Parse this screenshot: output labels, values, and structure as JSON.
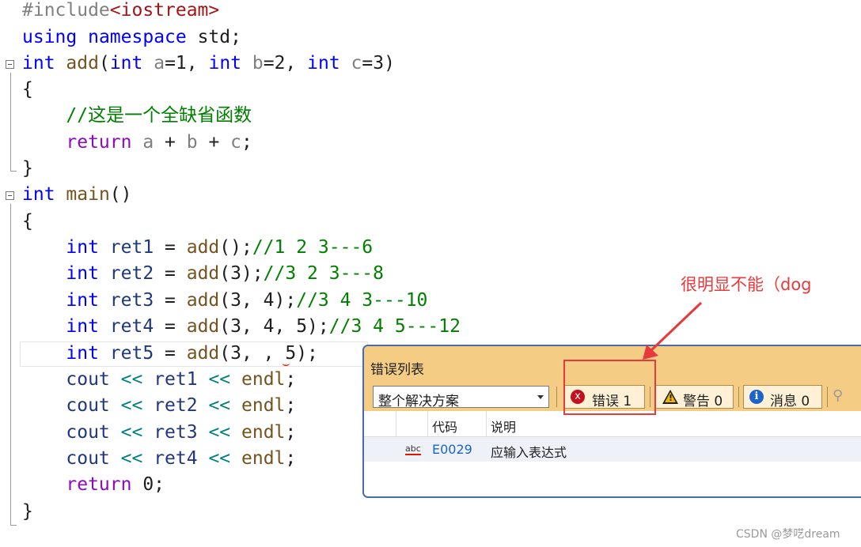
{
  "code": {
    "l1": {
      "a": "#include",
      "b": "<iostream>"
    },
    "l2": {
      "a": "using",
      "b": " ",
      "c": "namespace",
      "d": " std;"
    },
    "l3": {
      "a": "int",
      "b": " ",
      "c": "add",
      "d": "(",
      "e": "int",
      "f": " ",
      "g": "a",
      "h": "=1, ",
      "i": "int",
      "j": " ",
      "k": "b",
      "l": "=2, ",
      "m": "int",
      "n": " ",
      "o": "c",
      "p": "=3)"
    },
    "l4": {
      "a": "{"
    },
    "l5": {
      "a": "    ",
      "b": "//这是一个全缺省函数"
    },
    "l6": {
      "a": "    ",
      "b": "return",
      "c": " ",
      "d": "a",
      "e": " + ",
      "f": "b",
      "g": " + ",
      "h": "c",
      "i": ";"
    },
    "l7": {
      "a": "}"
    },
    "l8": {
      "a": "int",
      "b": " ",
      "c": "main",
      "d": "()"
    },
    "l9": {
      "a": "{"
    },
    "l10": {
      "a": "    ",
      "b": "int",
      "c": " ",
      "d": "ret1",
      "e": " = ",
      "f": "add",
      "g": "();",
      "h": "//1 2 3---6"
    },
    "l11": {
      "a": "    ",
      "b": "int",
      "c": " ",
      "d": "ret2",
      "e": " = ",
      "f": "add",
      "g": "(3);",
      "h": "//3 2 3---8"
    },
    "l12": {
      "a": "    ",
      "b": "int",
      "c": " ",
      "d": "ret3",
      "e": " = ",
      "f": "add",
      "g": "(3, 4);",
      "h": "//3 4 3---10"
    },
    "l13": {
      "a": "    ",
      "b": "int",
      "c": " ",
      "d": "ret4",
      "e": " = ",
      "f": "add",
      "g": "(3, 4, 5);",
      "h": "//3 4 5---12"
    },
    "l14": {
      "a": "    ",
      "b": "int",
      "c": " ",
      "d": "ret5",
      "e": " = ",
      "f": "add",
      "g": "(3, , 5);"
    },
    "l15": {
      "a": "    ",
      "b": "cout",
      "c": " ",
      "d": "<<",
      "e": " ",
      "f": "ret1",
      "g": " ",
      "h": "<<",
      "i": " ",
      "j": "endl",
      "k": ";"
    },
    "l16": {
      "a": "    ",
      "b": "cout",
      "c": " ",
      "d": "<<",
      "e": " ",
      "f": "ret2",
      "g": " ",
      "h": "<<",
      "i": " ",
      "j": "endl",
      "k": ";"
    },
    "l17": {
      "a": "    ",
      "b": "cout",
      "c": " ",
      "d": "<<",
      "e": " ",
      "f": "ret3",
      "g": " ",
      "h": "<<",
      "i": " ",
      "j": "endl",
      "k": ";"
    },
    "l18": {
      "a": "    ",
      "b": "cout",
      "c": " ",
      "d": "<<",
      "e": " ",
      "f": "ret4",
      "g": " ",
      "h": "<<",
      "i": " ",
      "j": "endl",
      "k": ";"
    },
    "l19": {
      "a": "    ",
      "b": "return",
      "c": " 0;"
    },
    "l20": {
      "a": "}"
    }
  },
  "error_list": {
    "title": "错误列表",
    "scope_selected": "整个解决方案",
    "errors_label": "错误 1",
    "warnings_label": "警告 0",
    "messages_label": "消息 0",
    "col_code": "代码",
    "col_description": "说明",
    "rows": [
      {
        "code": "E0029",
        "description": "应输入表达式"
      }
    ]
  },
  "annotation": "很明显不能（dog",
  "watermark": "CSDN @梦呓dream",
  "icons": {
    "error": "x",
    "info": "i",
    "filter": "⚲",
    "squiggle": "⌣"
  },
  "colors": {
    "keyword": "#0000ff",
    "comment": "#008000",
    "panel_title": "#f5cc84",
    "annotation": "#e8393c"
  }
}
